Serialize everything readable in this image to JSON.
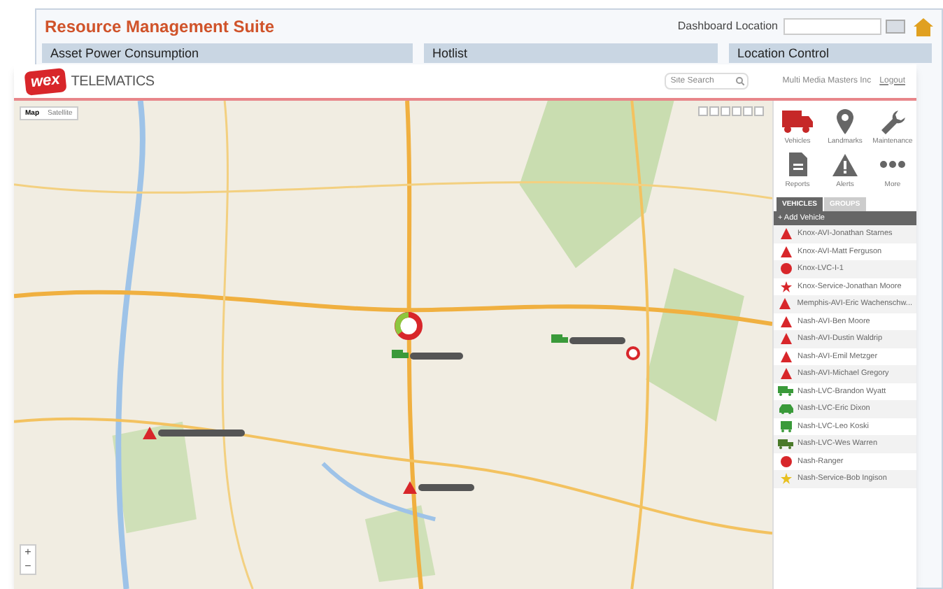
{
  "dashboard": {
    "title": "Resource Management Suite",
    "location_label": "Dashboard Location",
    "widgets": [
      {
        "title": "Asset Power Consumption"
      },
      {
        "title": "Hotlist"
      },
      {
        "title": "Location Control"
      }
    ]
  },
  "app": {
    "brand": {
      "logo": "wex",
      "name": "TELEMATICS"
    },
    "search": {
      "placeholder": "Site Search"
    },
    "account": "Multi Media Masters Inc",
    "logout": "Logout",
    "map": {
      "types": [
        {
          "label": "Map",
          "selected": true
        },
        {
          "label": "Satellite",
          "selected": false
        }
      ],
      "zoom_in": "+",
      "zoom_out": "−"
    },
    "nav": [
      {
        "kind": "truck",
        "label": "Vehicles"
      },
      {
        "kind": "pin",
        "label": "Landmarks"
      },
      {
        "kind": "wrench",
        "label": "Maintenance"
      },
      {
        "kind": "report",
        "label": "Reports"
      },
      {
        "kind": "alert",
        "label": "Alerts"
      },
      {
        "kind": "more",
        "label": "More"
      }
    ],
    "tabs": [
      {
        "label": "VEHICLES",
        "selected": true
      },
      {
        "label": "GROUPS",
        "selected": false
      }
    ],
    "add_vehicle": "+ Add Vehicle",
    "vehicles": [
      {
        "name": "Knox-AVI-Jonathan Starnes",
        "kind": "triangle",
        "color": "#d8262a"
      },
      {
        "name": "Knox-AVI-Matt Ferguson",
        "kind": "triangle",
        "color": "#d8262a"
      },
      {
        "name": "Knox-LVC-I-1",
        "kind": "circle",
        "color": "#d8262a"
      },
      {
        "name": "Knox-Service-Jonathan Moore",
        "kind": "star",
        "color": "#d8262a"
      },
      {
        "name": "Memphis-AVI-Eric Wachenschw...",
        "kind": "triangle",
        "color": "#d8262a"
      },
      {
        "name": "Nash-AVI-Ben Moore",
        "kind": "triangle",
        "color": "#d8262a"
      },
      {
        "name": "Nash-AVI-Dustin Waldrip",
        "kind": "triangle",
        "color": "#d8262a"
      },
      {
        "name": "Nash-AVI-Emil Metzger",
        "kind": "triangle",
        "color": "#d8262a"
      },
      {
        "name": "Nash-AVI-Michael Gregory",
        "kind": "triangle",
        "color": "#d8262a"
      },
      {
        "name": "Nash-LVC-Brandon Wyatt",
        "kind": "truck",
        "color": "#3a9a3a"
      },
      {
        "name": "Nash-LVC-Eric Dixon",
        "kind": "car",
        "color": "#3a9a3a"
      },
      {
        "name": "Nash-LVC-Leo Koski",
        "kind": "jeep",
        "color": "#3a9a3a"
      },
      {
        "name": "Nash-LVC-Wes Warren",
        "kind": "truck",
        "color": "#4a7a2a"
      },
      {
        "name": "Nash-Ranger",
        "kind": "circle",
        "color": "#d8262a"
      },
      {
        "name": "Nash-Service-Bob Ingison",
        "kind": "star",
        "color": "#e8c020"
      }
    ]
  }
}
